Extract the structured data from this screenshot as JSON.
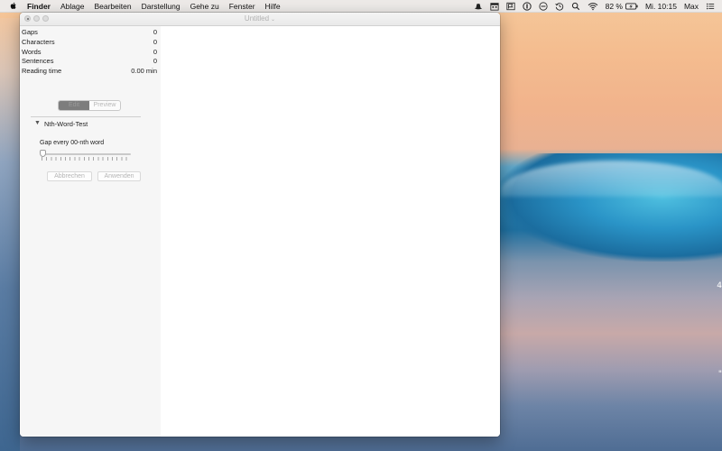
{
  "menubar": {
    "app_name": "Finder",
    "items": [
      "Ablage",
      "Bearbeiten",
      "Darstellung",
      "Gehe zu",
      "Fenster",
      "Hilfe"
    ],
    "status": {
      "battery": "82 %",
      "clock": "Mi. 10:15",
      "user": "Max"
    },
    "status_icons": [
      "hat-icon",
      "calendar-icon",
      "flag-icon",
      "onepassword-icon",
      "minus-circle-icon",
      "time-machine-icon",
      "search-icon",
      "wifi-icon",
      "battery-icon",
      "list-icon"
    ]
  },
  "window": {
    "title": "Untitled"
  },
  "stats": [
    {
      "label": "Gaps",
      "value": "0"
    },
    {
      "label": "Characters",
      "value": "0"
    },
    {
      "label": "Words",
      "value": "0"
    },
    {
      "label": "Sentences",
      "value": "0"
    },
    {
      "label": "Reading time",
      "value": "0.00 min"
    }
  ],
  "segmented": {
    "options": [
      "Edit",
      "Preview"
    ],
    "selected": "Edit"
  },
  "section": {
    "title": "Nth-Word-Test",
    "gap_label": "Gap every 00-nth word",
    "slider_fraction": 0.0,
    "cancel_label": "Abbrechen",
    "apply_label": "Anwenden"
  },
  "desktop": {
    "edge_marks": [
      "4",
      "\""
    ]
  },
  "colors": {
    "accent": "#7d7d7d",
    "window_bg": "#ffffff",
    "sidebar_bg": "#f6f6f6"
  }
}
